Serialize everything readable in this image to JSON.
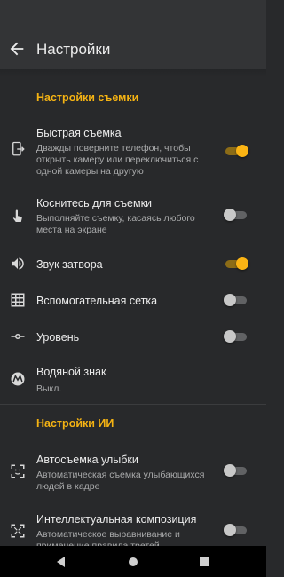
{
  "appbar": {
    "title": "Настройки",
    "back_icon": "arrow-back-icon"
  },
  "sections": {
    "camera": {
      "title": "Настройки съемки",
      "items": [
        {
          "title": "Быстрая съемка",
          "subtitle": "Дважды поверните телефон, чтобы открыть камеру или переключиться с одной камеры на другую",
          "icon": "phone-rotate-icon",
          "toggle": true
        },
        {
          "title": "Коснитесь для съемки",
          "subtitle": "Выполняйте съемку, касаясь любого места на экране",
          "icon": "touch-icon",
          "toggle": false
        },
        {
          "title": "Звук затвора",
          "icon": "volume-icon",
          "toggle": true
        },
        {
          "title": "Вспомогательная сетка",
          "icon": "grid-icon",
          "toggle": false
        },
        {
          "title": "Уровень",
          "icon": "level-icon",
          "toggle": false
        },
        {
          "title": "Водяной знак",
          "subtitle": "Выкл.",
          "icon": "motorola-logo-icon"
        }
      ]
    },
    "ai": {
      "title": "Настройки ИИ",
      "items": [
        {
          "title": "Автосъемка улыбки",
          "subtitle": "Автоматическая съемка улыбающихся людей в кадре",
          "icon": "face-frame-icon",
          "toggle": false
        },
        {
          "title": "Интеллектуальная композиция",
          "subtitle": "Автоматическое выравнивание и применение правила третей",
          "icon": "composition-icon",
          "toggle": false
        }
      ]
    }
  },
  "colors": {
    "accent": "#f5b313",
    "background": "#28292b",
    "appbar": "#333436"
  },
  "navbar": {
    "back": "nav-back-icon",
    "home": "nav-home-icon",
    "recents": "nav-recents-icon"
  }
}
